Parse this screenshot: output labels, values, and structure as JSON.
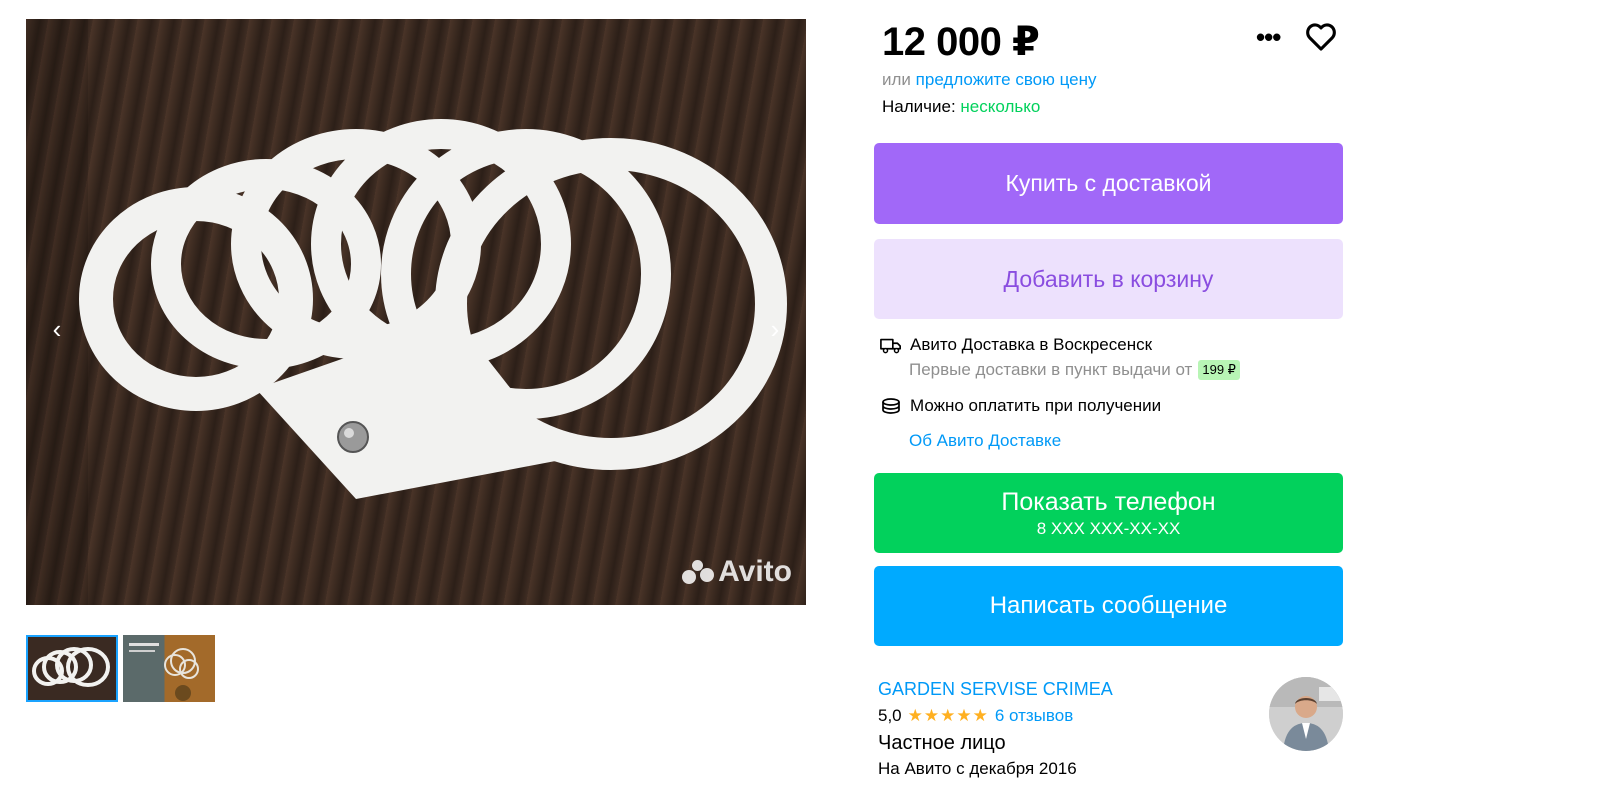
{
  "listing": {
    "price": "12 000 ₽",
    "offer_prefix": "или",
    "offer_link": "предложите свою цену",
    "availability_label": "Наличие:",
    "availability_value": "несколько"
  },
  "buttons": {
    "buy": "Купить с доставкой",
    "cart": "Добавить в корзину",
    "phone_main": "Показать телефон",
    "phone_sub": "8 XXX XXX-XX-XX",
    "message": "Написать сообщение"
  },
  "delivery": {
    "title": "Авито Доставка в Воскресенск",
    "subtitle": "Первые доставки в пункт выдачи от",
    "badge": "199 ₽",
    "payment": "Можно оплатить при получении",
    "about_link": "Об Авито Доставке"
  },
  "seller": {
    "name": "GARDEN SERVISE CRIMEA",
    "rating": "5,0",
    "stars": "★★★★★",
    "reviews": "6 отзывов",
    "type": "Частное лицо",
    "since": "На Авито с декабря 2016"
  },
  "gallery": {
    "watermark": "Avito",
    "prev_arrow": "‹",
    "next_arrow": "›",
    "thumbnail_count": 2
  },
  "icons": {
    "more": "more-dots-icon",
    "favorite": "heart-icon",
    "delivery": "truck-icon",
    "payment": "coins-icon"
  },
  "colors": {
    "buy_button": "#a168f8",
    "cart_button": "#ede1fd",
    "phone_button": "#02d15c",
    "message_button": "#00aaff",
    "link": "#0099f7",
    "availability": "#02d15c"
  }
}
